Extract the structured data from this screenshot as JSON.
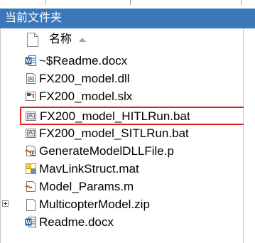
{
  "panel": {
    "title": "当前文件夹",
    "column_header": "名称",
    "sort_direction": "ascending"
  },
  "files": [
    {
      "name": "~$Readme.docx",
      "icon": "word-doc-icon"
    },
    {
      "name": "FX200_model.dll",
      "icon": "dll-file-icon"
    },
    {
      "name": "FX200_model.slx",
      "icon": "simulink-model-icon"
    },
    {
      "name": "FX200_model_HITLRun.bat",
      "icon": "bat-file-icon",
      "highlighted": true
    },
    {
      "name": "FX200_model_SITLRun.bat",
      "icon": "bat-file-icon"
    },
    {
      "name": "GenerateModelDLLFile.p",
      "icon": "p-file-icon"
    },
    {
      "name": "MavLinkStruct.mat",
      "icon": "mat-file-icon"
    },
    {
      "name": "Model_Params.m",
      "icon": "m-script-icon"
    },
    {
      "name": "MulticopterModel.zip",
      "icon": "zip-file-icon",
      "expandable": true
    },
    {
      "name": "Readme.docx",
      "icon": "word-doc-icon"
    }
  ],
  "colors": {
    "title_bar": "#3a77b8",
    "highlight_border": "#e02020",
    "word_icon": "#2b579a"
  }
}
